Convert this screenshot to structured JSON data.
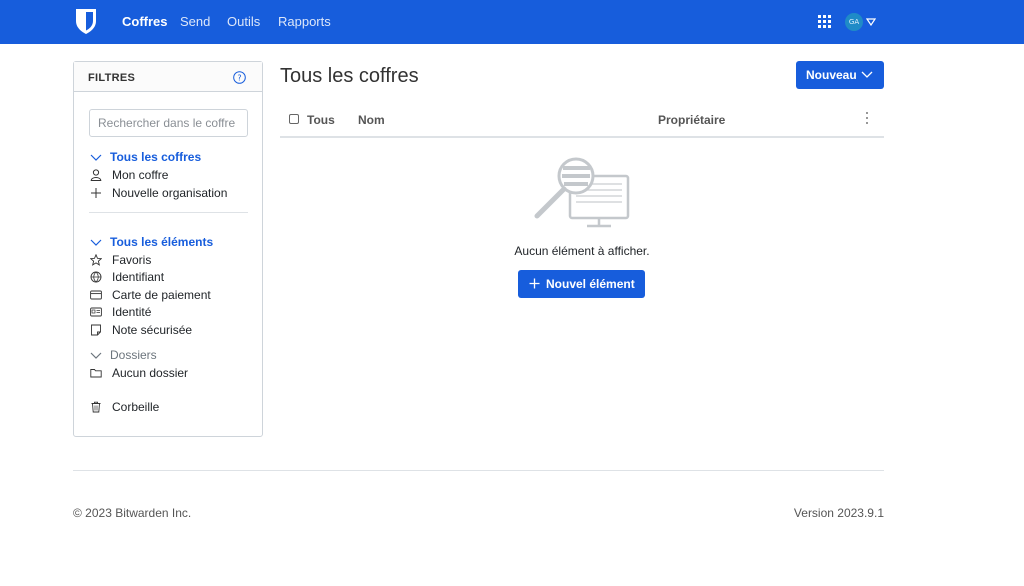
{
  "nav": {
    "links": [
      "Coffres",
      "Send",
      "Outils",
      "Rapports"
    ],
    "avatar_initials": "GA"
  },
  "filters": {
    "title": "FILTRES",
    "search_placeholder": "Rechercher dans le coffre",
    "vaults_heading": "Tous les coffres",
    "vault_items": [
      "Mon coffre",
      "Nouvelle organisation"
    ],
    "types_heading": "Tous les éléments",
    "type_items": [
      "Favoris",
      "Identifiant",
      "Carte de paiement",
      "Identité",
      "Note sécurisée"
    ],
    "folders_heading": "Dossiers",
    "folder_items": [
      "Aucun dossier"
    ],
    "trash": "Corbeille"
  },
  "main": {
    "title": "Tous les coffres",
    "new_button": "Nouveau",
    "columns": {
      "all": "Tous",
      "name": "Nom",
      "owner": "Propriétaire"
    },
    "empty_text": "Aucun élément à afficher.",
    "add_button": "Nouvel élément"
  },
  "footer": {
    "copyright": "© 2023 Bitwarden Inc.",
    "version": "Version 2023.9.1"
  },
  "colors": {
    "brand": "#175ddc"
  }
}
